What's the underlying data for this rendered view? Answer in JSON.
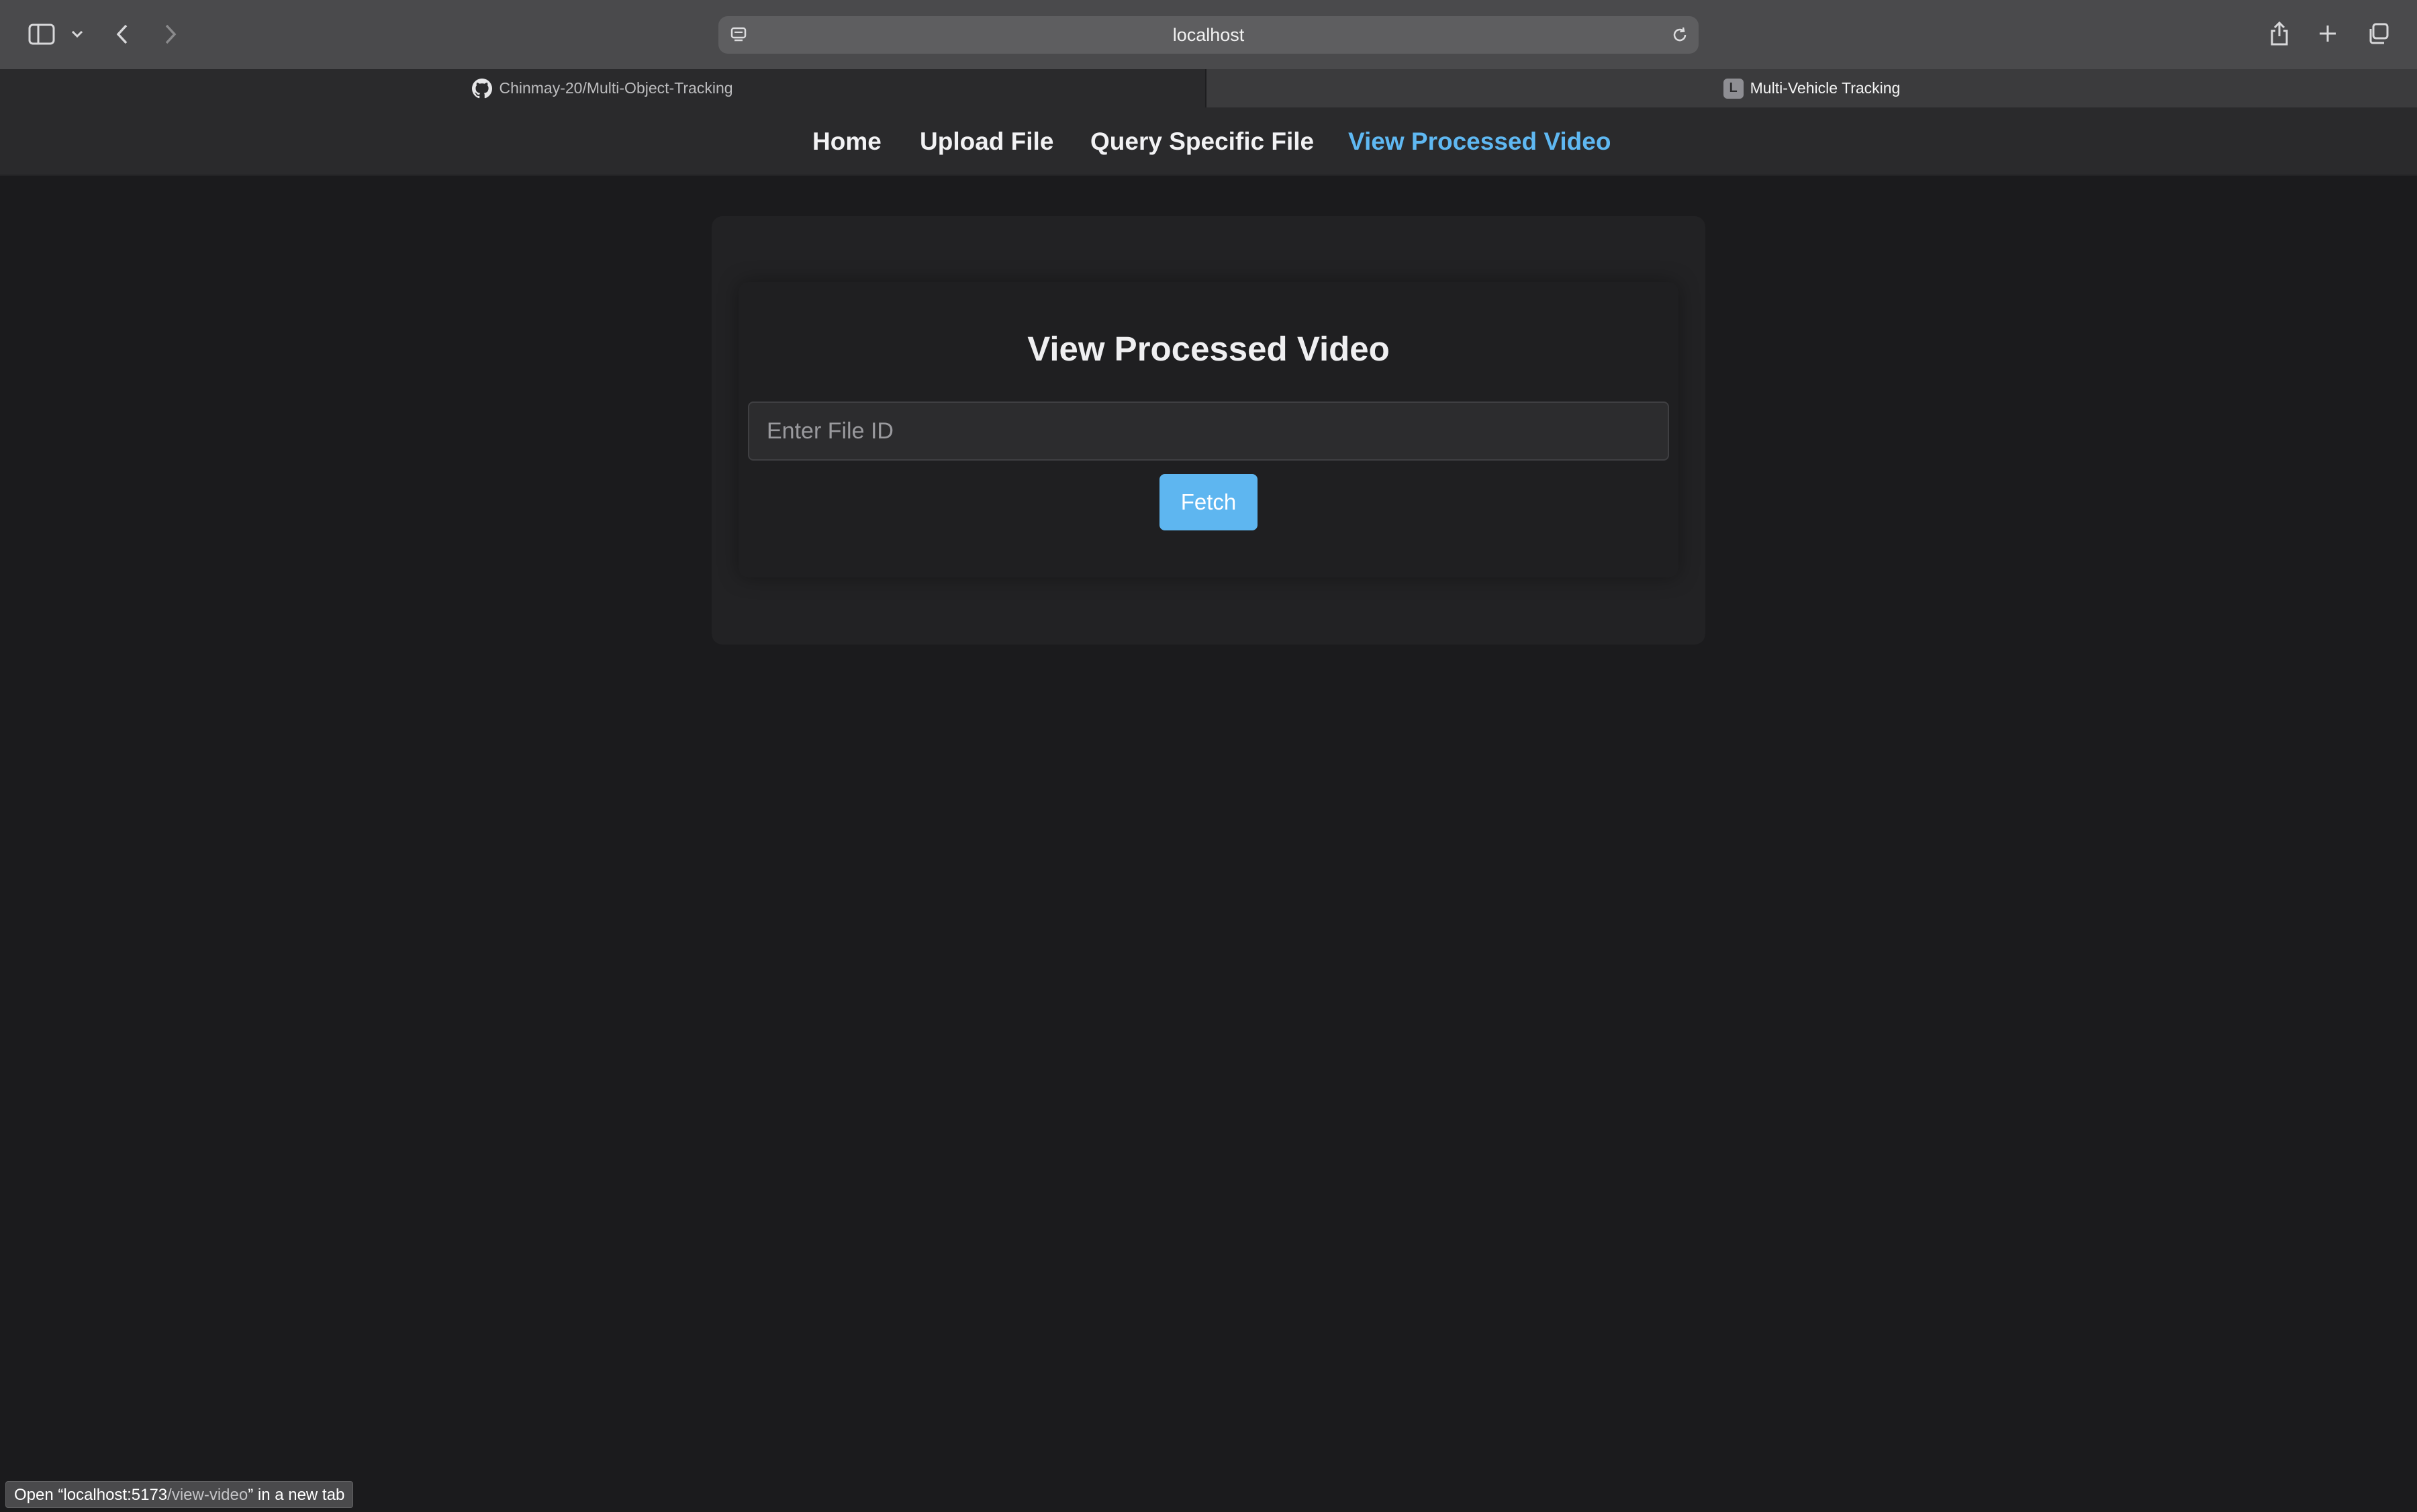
{
  "browser": {
    "url_text": "localhost",
    "tabs": [
      {
        "label": "Chinmay-20/Multi-Object-Tracking",
        "icon": "github-icon",
        "active": false
      },
      {
        "label": "Multi-Vehicle Tracking",
        "icon_letter": "L",
        "active": true
      }
    ],
    "status_tooltip": {
      "prefix": "Open “localhost:5173",
      "path": "/view-video",
      "suffix": "” in a new tab"
    }
  },
  "nav": {
    "items": [
      {
        "label": "Home",
        "active": false
      },
      {
        "label": "Upload File",
        "active": false
      },
      {
        "label": "Query Specific File",
        "active": false
      },
      {
        "label": "View Processed Video",
        "active": true
      }
    ],
    "active_color": "#5fb8f2"
  },
  "main": {
    "title": "View Processed Video",
    "file_id_input": {
      "placeholder": "Enter File ID",
      "value": ""
    },
    "fetch_label": "Fetch",
    "accent_color": "#5eb6f0"
  }
}
